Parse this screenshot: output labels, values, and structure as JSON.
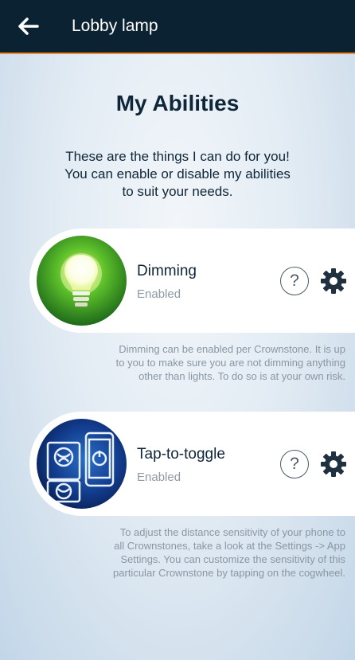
{
  "header": {
    "title": "Lobby lamp",
    "back_icon": "arrow-left-icon"
  },
  "page": {
    "heading": "My Abilities",
    "intro_lines": [
      "These are the things I can do for you!",
      "You can enable or disable my abilities",
      "to suit your needs."
    ]
  },
  "abilities": [
    {
      "title": "Dimming",
      "status": "Enabled",
      "help_label": "?",
      "icon": "lightbulb-icon",
      "description_lines": [
        "Dimming can be enabled per Crownstone. It is up",
        "to you to make sure you are not dimming anything",
        "other than lights. To do so is at your own risk."
      ]
    },
    {
      "title": "Tap-to-toggle",
      "status": "Enabled",
      "help_label": "?",
      "icon": "phone-tap-icon",
      "description_lines": [
        "To adjust the distance sensitivity of your phone to",
        "all Crownstones, take a look at the Settings -> App",
        "Settings. You can customize the sensitivity of this",
        "particular Crownstone by tapping on the cogwheel."
      ]
    }
  ],
  "colors": {
    "topbar": "#0b2233",
    "accent": "#f08a2a",
    "text_dark": "#0e2638",
    "text_muted": "#8a97a3"
  }
}
